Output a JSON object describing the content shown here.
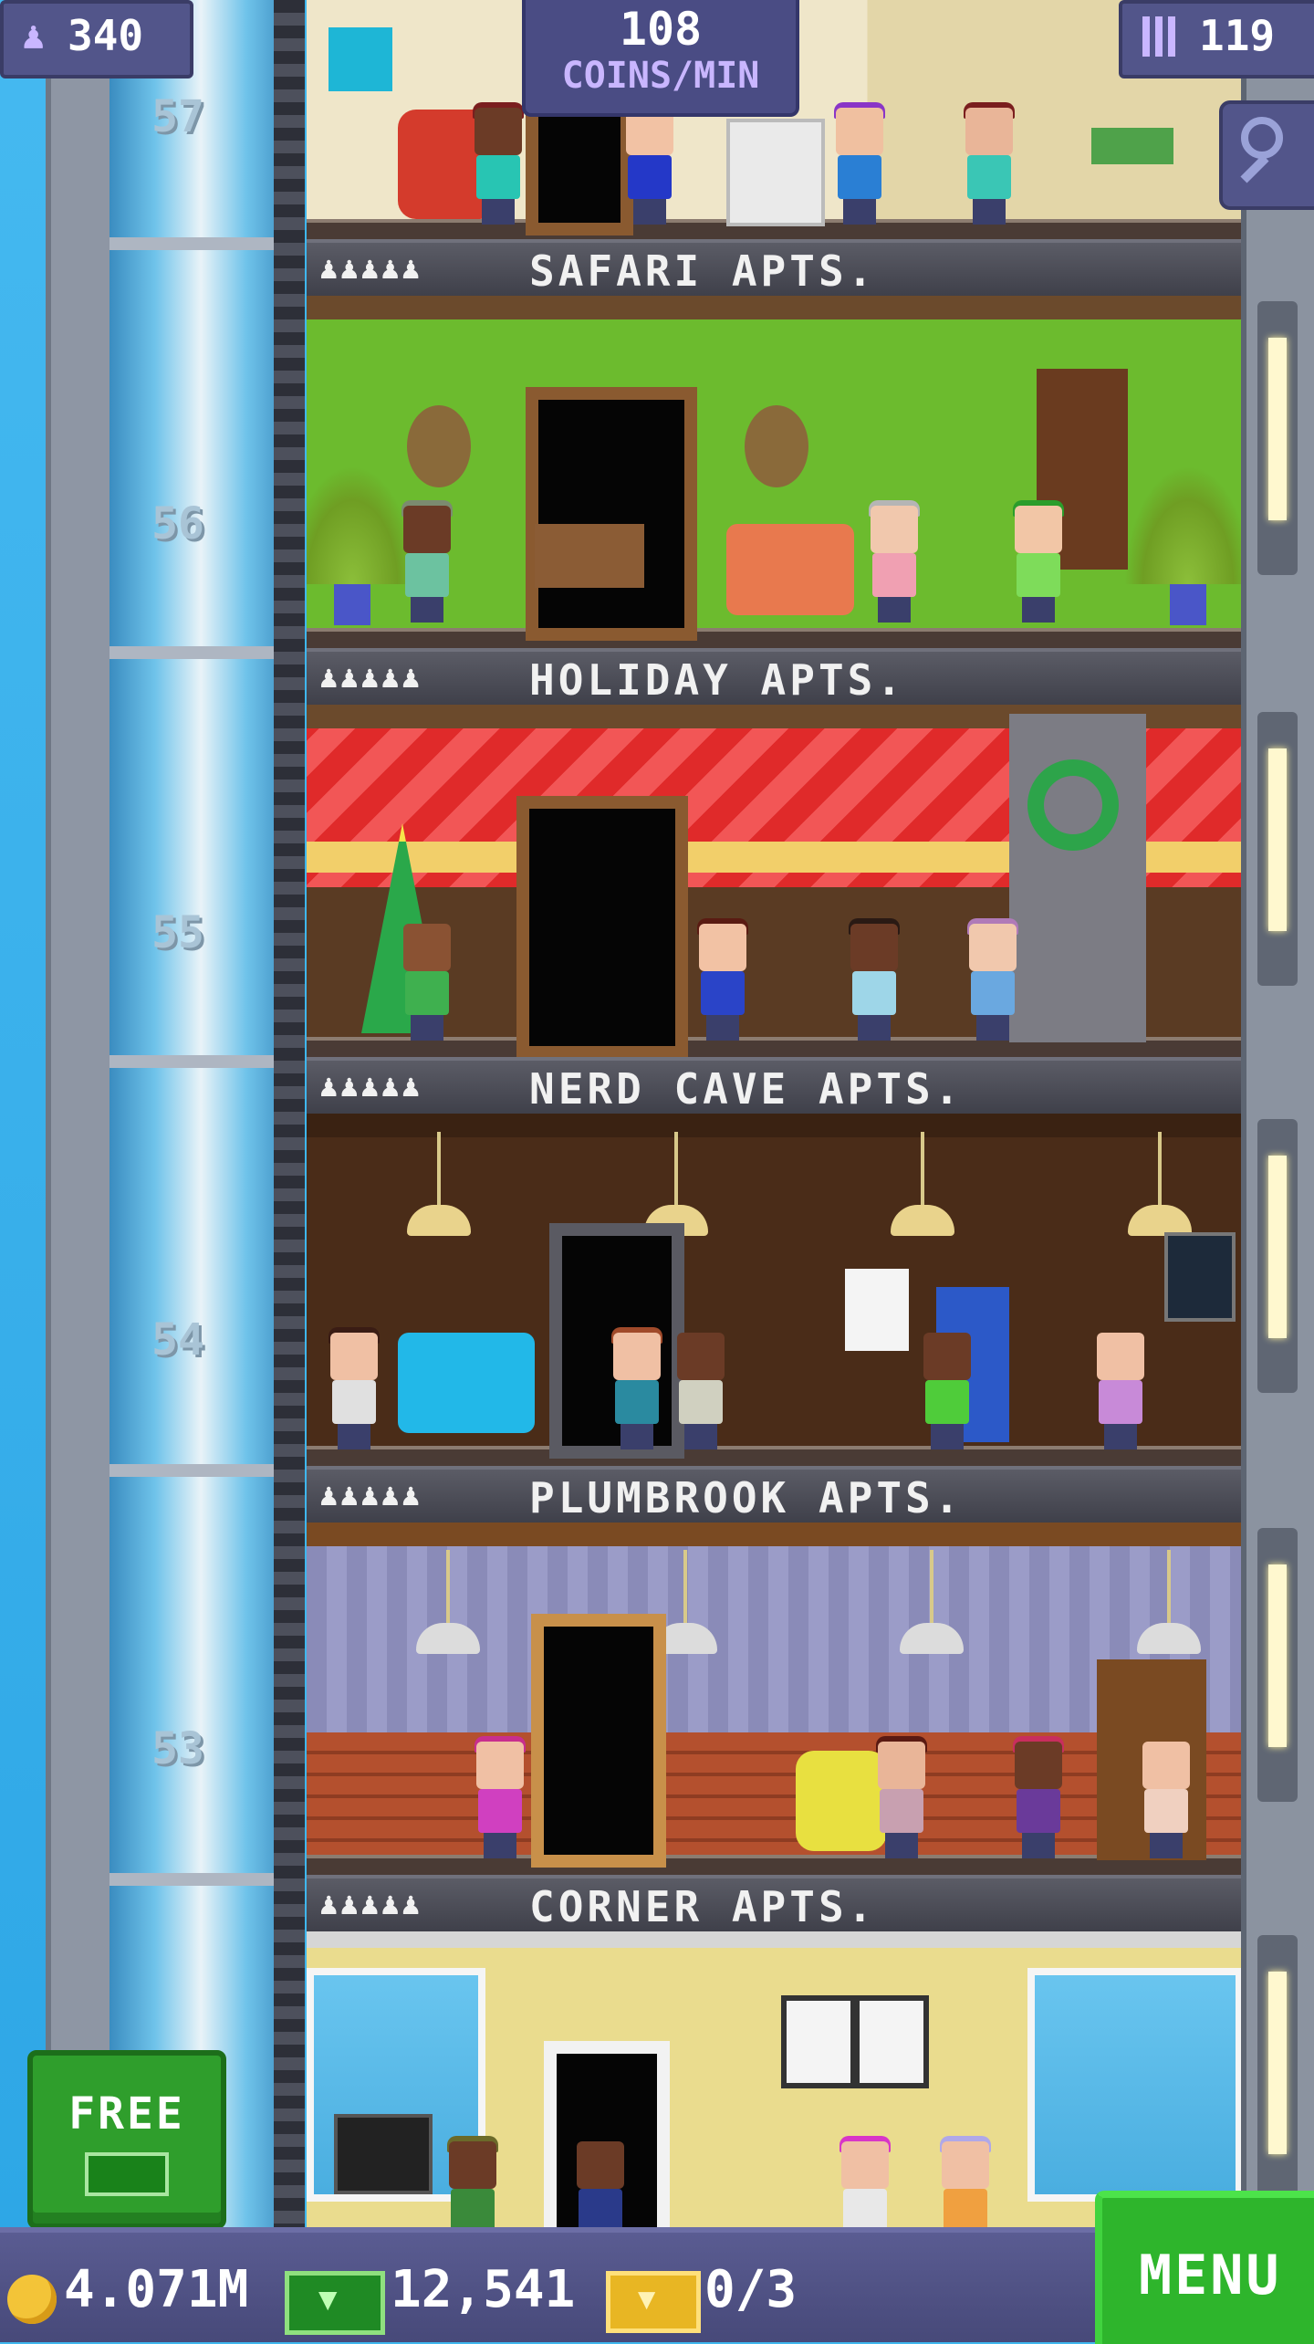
{
  "hud": {
    "population": "340",
    "coins_per_min_value": "108",
    "coins_per_min_label": "COINS/MIN",
    "floors": "119"
  },
  "elevator": {
    "floor_numbers": [
      "57",
      "56",
      "55",
      "54",
      "53"
    ]
  },
  "floors": [
    {
      "name": "SAFARI APTS.",
      "rating_icons": "♟♟♟♟♟"
    },
    {
      "name": "HOLIDAY APTS.",
      "rating_icons": "♟♟♟♟♟"
    },
    {
      "name": "NERD CAVE APTS.",
      "rating_icons": "♟♟♟♟♟"
    },
    {
      "name": "PLUMBROOK APTS.",
      "rating_icons": "♟♟♟♟♟"
    },
    {
      "name": "CORNER APTS.",
      "rating_icons": "♟♟♟♟♟"
    }
  ],
  "free_button": {
    "label": "FREE"
  },
  "bottom_bar": {
    "coins": "4.071M",
    "bux": "12,541",
    "tickets": "0/3",
    "menu_label": "MENU"
  },
  "icons": {
    "population": "person-icon",
    "floors": "building-icon",
    "search": "magnifier-icon",
    "coins": "coin-icon",
    "bux": "tower-bux-icon",
    "tickets": "golden-ticket-icon"
  },
  "colors": {
    "hud_panel": "#52558a",
    "menu_green": "#2eb52c",
    "sky": "#3fb7ee"
  }
}
